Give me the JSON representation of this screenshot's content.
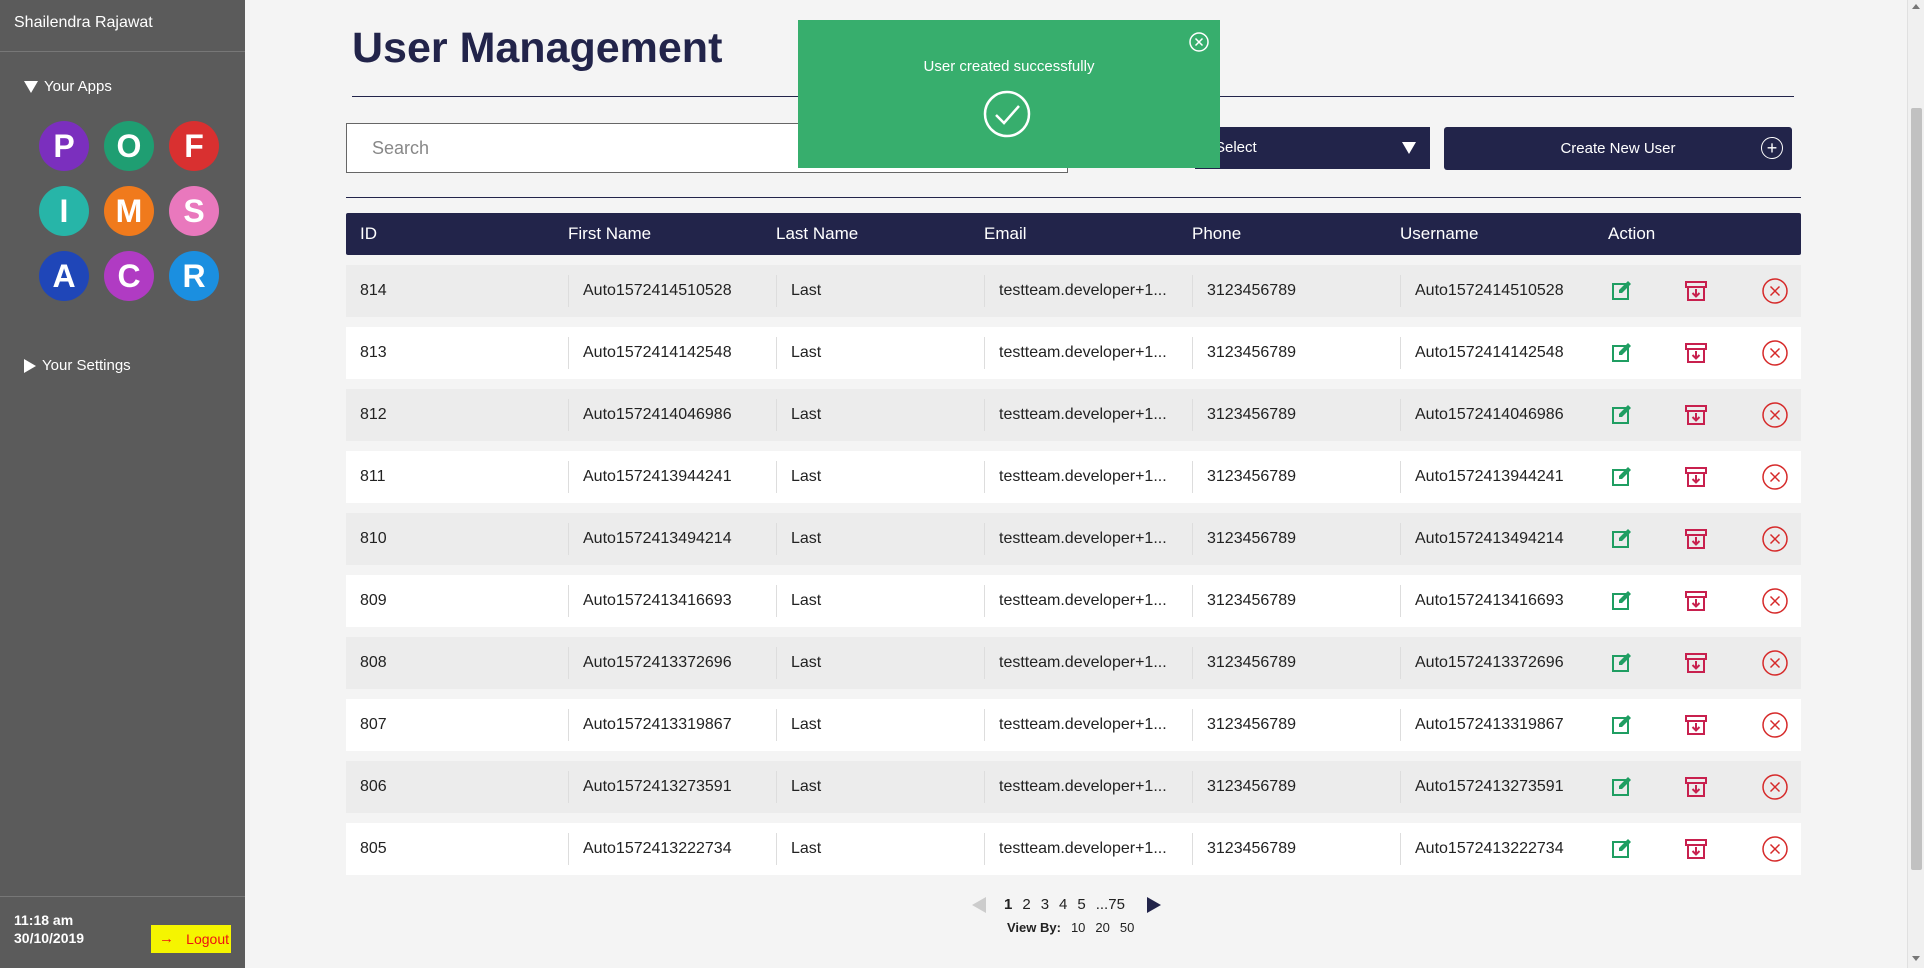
{
  "sidebar": {
    "user_name": "Shailendra Rajawat",
    "apps_label": "Your Apps",
    "settings_label": "Your Settings",
    "apps": [
      {
        "letter": "P",
        "color": "#7b2fbe"
      },
      {
        "letter": "O",
        "color": "#1f9e72"
      },
      {
        "letter": "F",
        "color": "#d93030"
      },
      {
        "letter": "I",
        "color": "#27b5a8"
      },
      {
        "letter": "M",
        "color": "#f07a1c"
      },
      {
        "letter": "S",
        "color": "#e978bd"
      },
      {
        "letter": "A",
        "color": "#1f46b8"
      },
      {
        "letter": "C",
        "color": "#b03bc3"
      },
      {
        "letter": "R",
        "color": "#1b8fe0"
      }
    ],
    "time": "11:18 am",
    "date": "30/10/2019",
    "logout_label": "Logout"
  },
  "header": {
    "title": "User Management"
  },
  "toolbar": {
    "search_placeholder": "Search",
    "select_label": "Select",
    "create_label": "Create New User"
  },
  "toast": {
    "message": "User created successfully",
    "color": "#37ae6d"
  },
  "table": {
    "columns": [
      "ID",
      "First Name",
      "Last Name",
      "Email",
      "Phone",
      "Username",
      "Action"
    ],
    "rows": [
      {
        "id": "814",
        "first": "Auto1572414510528",
        "last": "Last",
        "email": "testteam.developer+1...",
        "phone": "3123456789",
        "username": "Auto1572414510528"
      },
      {
        "id": "813",
        "first": "Auto1572414142548",
        "last": "Last",
        "email": "testteam.developer+1...",
        "phone": "3123456789",
        "username": "Auto1572414142548"
      },
      {
        "id": "812",
        "first": "Auto1572414046986",
        "last": "Last",
        "email": "testteam.developer+1...",
        "phone": "3123456789",
        "username": "Auto1572414046986"
      },
      {
        "id": "811",
        "first": "Auto1572413944241",
        "last": "Last",
        "email": "testteam.developer+1...",
        "phone": "3123456789",
        "username": "Auto1572413944241"
      },
      {
        "id": "810",
        "first": "Auto1572413494214",
        "last": "Last",
        "email": "testteam.developer+1...",
        "phone": "3123456789",
        "username": "Auto1572413494214"
      },
      {
        "id": "809",
        "first": "Auto1572413416693",
        "last": "Last",
        "email": "testteam.developer+1...",
        "phone": "3123456789",
        "username": "Auto1572413416693"
      },
      {
        "id": "808",
        "first": "Auto1572413372696",
        "last": "Last",
        "email": "testteam.developer+1...",
        "phone": "3123456789",
        "username": "Auto1572413372696"
      },
      {
        "id": "807",
        "first": "Auto1572413319867",
        "last": "Last",
        "email": "testteam.developer+1...",
        "phone": "3123456789",
        "username": "Auto1572413319867"
      },
      {
        "id": "806",
        "first": "Auto1572413273591",
        "last": "Last",
        "email": "testteam.developer+1...",
        "phone": "3123456789",
        "username": "Auto1572413273591"
      },
      {
        "id": "805",
        "first": "Auto1572413222734",
        "last": "Last",
        "email": "testteam.developer+1...",
        "phone": "3123456789",
        "username": "Auto1572413222734"
      }
    ],
    "action_icons": [
      "edit-icon",
      "archive-icon",
      "delete-icon"
    ],
    "action_colors": {
      "edit": "#1f9e62",
      "archive": "#c8204e",
      "delete": "#d62a2a"
    }
  },
  "pagination": {
    "pages": [
      "1",
      "2",
      "3",
      "4",
      "5",
      "...75"
    ],
    "current": "1",
    "view_by_label": "View By:",
    "view_by_options": [
      "10",
      "20",
      "50"
    ]
  },
  "colors": {
    "primary": "#22244a",
    "sidebar_bg": "#5b5b5b",
    "page_bg": "#f4f4f4"
  }
}
